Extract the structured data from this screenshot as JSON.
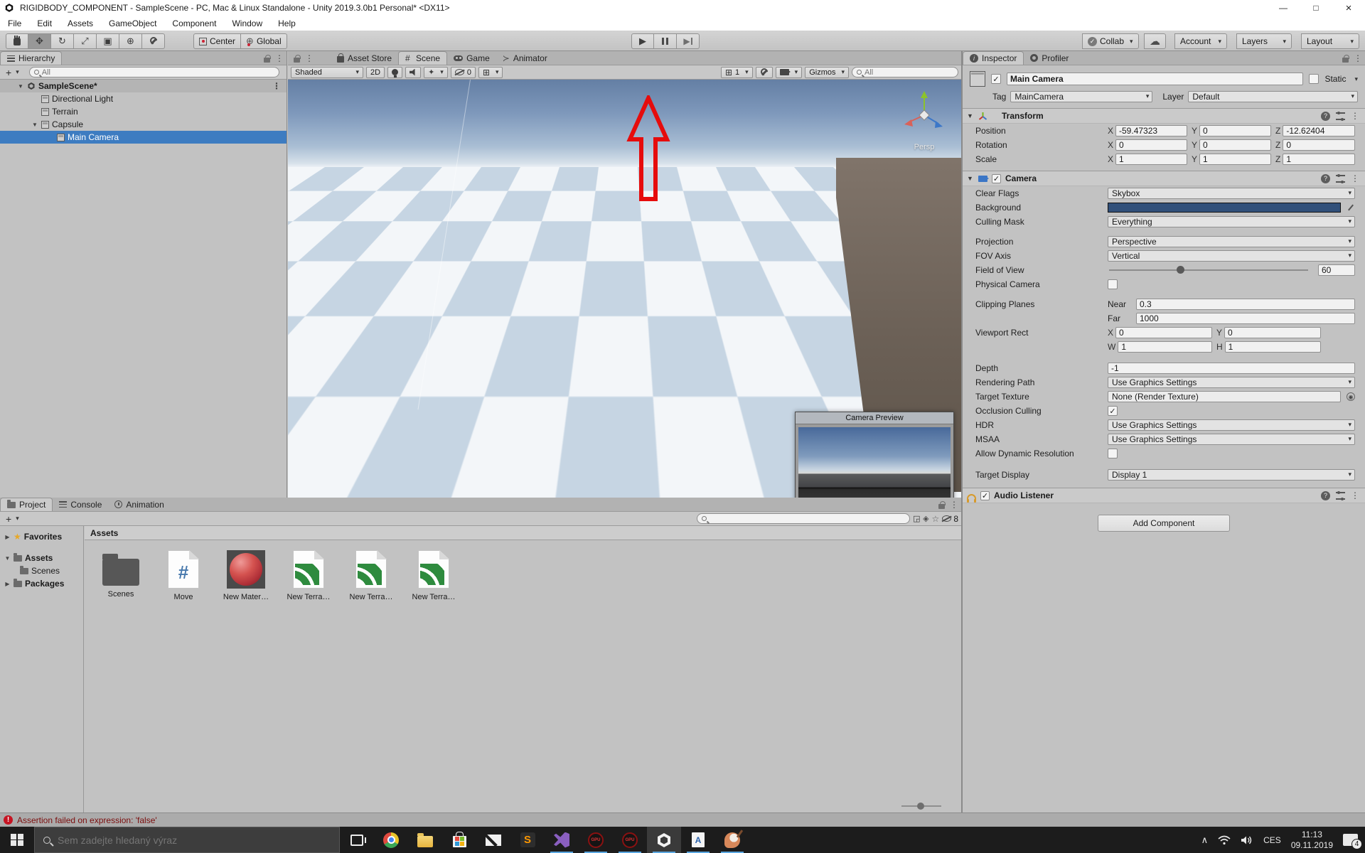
{
  "titlebar": {
    "title": "RIGIDBODY_COMPONENT - SampleScene - PC, Mac & Linux Standalone - Unity 2019.3.0b1 Personal* <DX11>",
    "minimize": "—",
    "maximize": "□",
    "close": "×"
  },
  "menubar": {
    "file": "File",
    "edit": "Edit",
    "assets": "Assets",
    "gameobject": "GameObject",
    "component": "Component",
    "window": "Window",
    "help": "Help"
  },
  "toolbar": {
    "center": "Center",
    "global": "Global",
    "collab": "Collab",
    "account": "Account",
    "layers": "Layers",
    "layout": "Layout"
  },
  "hierarchy": {
    "tab": "Hierarchy",
    "add_label": "+",
    "search_placeholder": "All",
    "scene": "SampleScene*",
    "directional_light": "Directional Light",
    "terrain": "Terrain",
    "capsule": "Capsule",
    "main_camera": "Main Camera"
  },
  "scene": {
    "tabs": {
      "asset_store": "Asset Store",
      "scene": "Scene",
      "game": "Game",
      "animator": "Animator"
    },
    "toolbar": {
      "shading": "Shaded",
      "mode_2d": "2D",
      "hidden_count": "0",
      "grid_scale": "1",
      "gizmos": "Gizmos",
      "search_placeholder": "All"
    },
    "persp_label": "Persp",
    "camera_preview_title": "Camera Preview"
  },
  "inspector": {
    "tab_inspector": "Inspector",
    "tab_profiler": "Profiler",
    "name": "Main Camera",
    "static_label": "Static",
    "tag_label": "Tag",
    "tag": "MainCamera",
    "layer_label": "Layer",
    "layer": "Default",
    "transform": {
      "title": "Transform",
      "position_label": "Position",
      "rotation_label": "Rotation",
      "scale_label": "Scale",
      "x": "X",
      "y": "Y",
      "z": "Z",
      "position": {
        "x": "-59.47323",
        "y": "0",
        "z": "-12.62404"
      },
      "rotation": {
        "x": "0",
        "y": "0",
        "z": "0"
      },
      "scale": {
        "x": "1",
        "y": "1",
        "z": "1"
      }
    },
    "camera": {
      "title": "Camera",
      "clear_flags_label": "Clear Flags",
      "clear_flags": "Skybox",
      "background_label": "Background",
      "background_color": "#31507a",
      "background_style": "background:#31507a",
      "culling_mask_label": "Culling Mask",
      "culling_mask": "Everything",
      "projection_label": "Projection",
      "projection": "Perspective",
      "fov_axis_label": "FOV Axis",
      "fov_axis": "Vertical",
      "field_of_view_label": "Field of View",
      "field_of_view": "60",
      "physical_camera_label": "Physical Camera",
      "clipping_planes_label": "Clipping Planes",
      "near_label": "Near",
      "near": "0.3",
      "far_label": "Far",
      "far": "1000",
      "viewport_rect_label": "Viewport Rect",
      "w_label": "W",
      "h_label": "H",
      "viewport": {
        "x": "0",
        "y": "0",
        "w": "1",
        "h": "1"
      },
      "depth_label": "Depth",
      "depth": "-1",
      "rendering_path_label": "Rendering Path",
      "rendering_path": "Use Graphics Settings",
      "target_texture_label": "Target Texture",
      "target_texture": "None (Render Texture)",
      "occlusion_label": "Occlusion Culling",
      "occlusion_checked": "✓",
      "hdr_label": "HDR",
      "hdr": "Use Graphics Settings",
      "msaa_label": "MSAA",
      "msaa": "Use Graphics Settings",
      "dynamic_res_label": "Allow Dynamic Resolution",
      "target_display_label": "Target Display",
      "target_display": "Display 1"
    },
    "audio_listener": {
      "title": "Audio Listener",
      "checked": "✓"
    },
    "enabled_check": "✓",
    "add_component": "Add Component"
  },
  "project": {
    "tabs": {
      "project": "Project",
      "console": "Console",
      "animation": "Animation"
    },
    "add_label": "+",
    "favorites": "Favorites",
    "assets_folder": "Assets",
    "scenes_folder": "Scenes",
    "packages": "Packages",
    "assets_header": "Assets",
    "hidden_count": "8",
    "items": [
      {
        "name": "Scenes"
      },
      {
        "name": "Move"
      },
      {
        "name": "New Mater…"
      },
      {
        "name": "New Terra…"
      },
      {
        "name": "New Terra…"
      },
      {
        "name": "New Terra…"
      }
    ]
  },
  "statusbar": {
    "message": "Assertion failed on expression: 'false'"
  },
  "taskbar": {
    "search_placeholder": "Sem zadejte hledaný výraz",
    "lang": "CES",
    "time": "11:13",
    "date": "09.11.2019",
    "notification_count": "4"
  }
}
